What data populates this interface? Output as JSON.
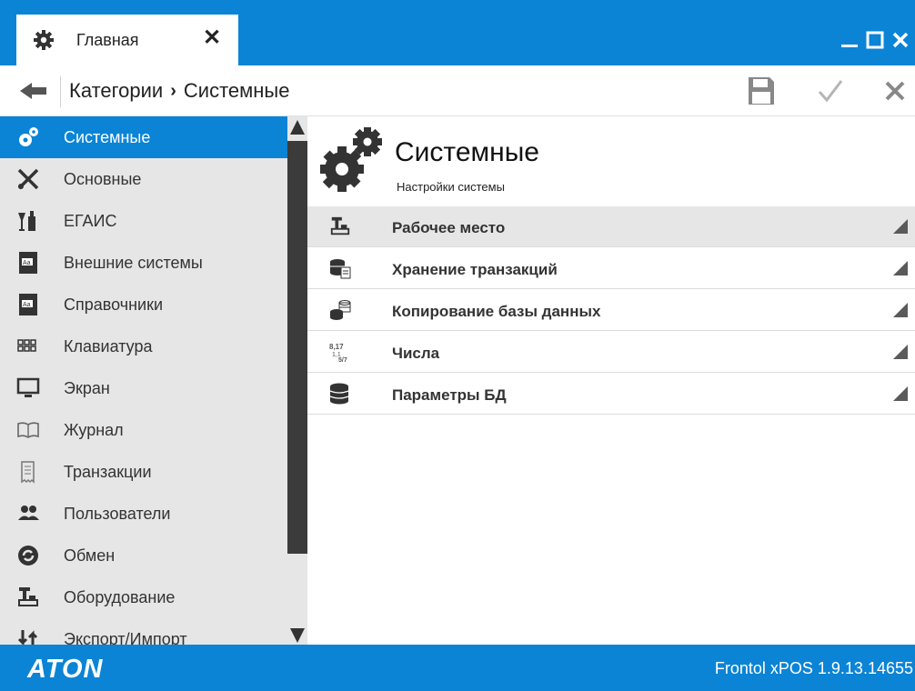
{
  "tab": {
    "label": "Главная"
  },
  "breadcrumb": {
    "parent": "Категории",
    "separator": "›",
    "current": "Системные"
  },
  "sidebar": {
    "items": [
      {
        "label": "Системные",
        "icon": "gears-icon",
        "active": true
      },
      {
        "label": "Основные",
        "icon": "tools-icon"
      },
      {
        "label": "ЕГАИС",
        "icon": "bottles-icon"
      },
      {
        "label": "Внешние системы",
        "icon": "book-icon"
      },
      {
        "label": "Справочники",
        "icon": "book-icon"
      },
      {
        "label": "Клавиатура",
        "icon": "keyboard-icon"
      },
      {
        "label": "Экран",
        "icon": "monitor-icon"
      },
      {
        "label": "Журнал",
        "icon": "journal-icon"
      },
      {
        "label": "Транзакции",
        "icon": "receipt-icon"
      },
      {
        "label": "Пользователи",
        "icon": "users-icon"
      },
      {
        "label": "Обмен",
        "icon": "exchange-icon"
      },
      {
        "label": "Оборудование",
        "icon": "pos-terminal-icon"
      },
      {
        "label": "Экспорт/Импорт",
        "icon": "export-import-icon"
      }
    ]
  },
  "main": {
    "title": "Системные",
    "subtitle": "Настройки системы",
    "rows": [
      {
        "label": "Рабочее место",
        "icon": "pos-terminal-icon",
        "selected": true
      },
      {
        "label": "Хранение транзакций",
        "icon": "database-doc-icon"
      },
      {
        "label": "Копирование базы данных",
        "icon": "database-copy-icon"
      },
      {
        "label": "Числа",
        "icon": "numbers-icon"
      },
      {
        "label": "Параметры БД",
        "icon": "database-icon"
      }
    ]
  },
  "status": {
    "brand": "ATON",
    "version": "Frontol xPOS 1.9.13.14655"
  },
  "colors": {
    "accent": "#0b84d6",
    "sidebar_bg": "#e6e6e6",
    "selected_row": "#e6e6e6",
    "icon_dark": "#3a3a3a"
  }
}
